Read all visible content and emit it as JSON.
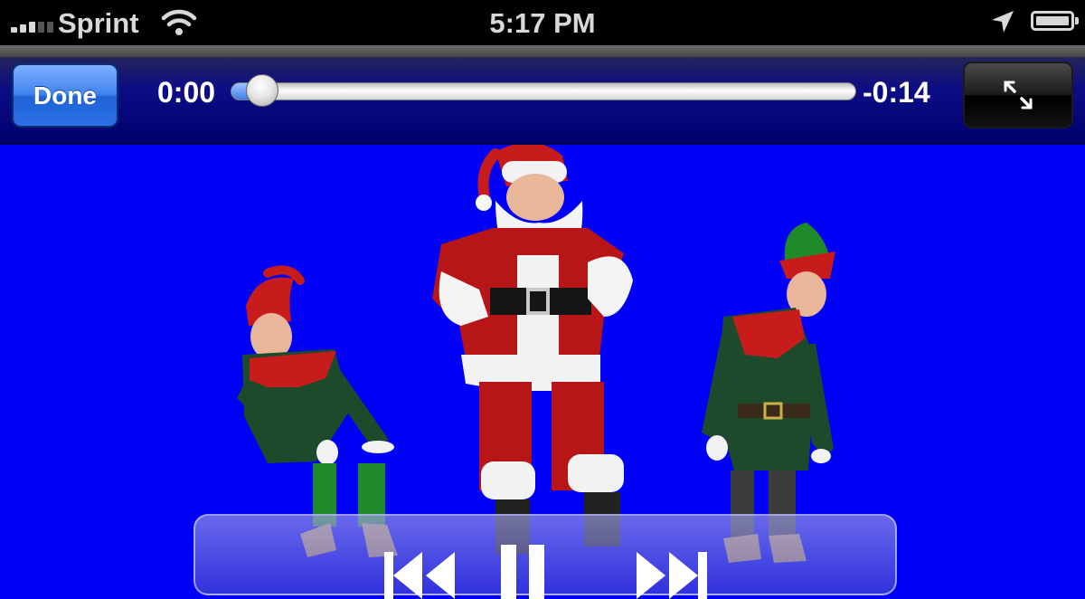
{
  "status_bar": {
    "carrier": "Sprint",
    "time": "5:17 PM",
    "icons": [
      "signal-icon",
      "wifi-icon",
      "location-arrow-icon",
      "battery-icon"
    ]
  },
  "player": {
    "done_label": "Done",
    "elapsed": "0:00",
    "remaining": "-0:14",
    "progress": 0.05,
    "fullscreen_icon": "fullscreen-toggle-icon"
  },
  "video": {
    "background_color": "#0000f6",
    "scene": [
      "elf-left",
      "santa",
      "elf-right"
    ]
  },
  "controls": {
    "icons": [
      "previous-track-icon",
      "pause-icon",
      "next-track-icon"
    ]
  }
}
